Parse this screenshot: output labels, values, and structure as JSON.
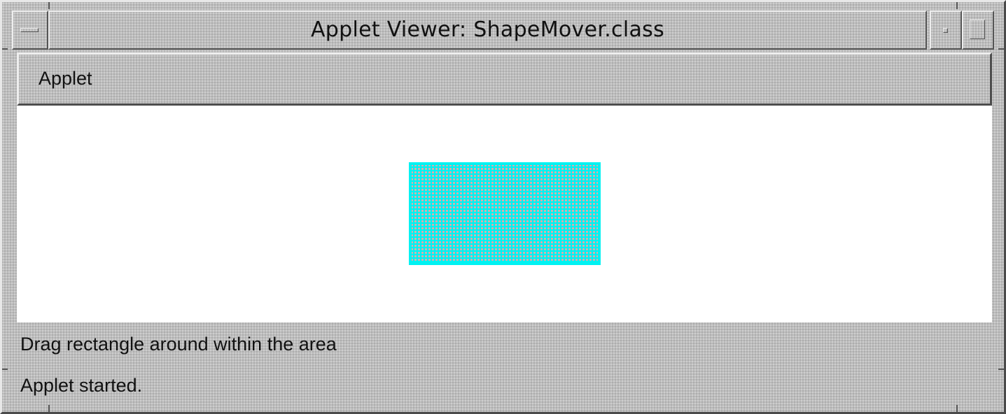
{
  "window": {
    "title": "Applet Viewer: ShapeMover.class"
  },
  "menubar": {
    "items": [
      {
        "label": "Applet"
      }
    ]
  },
  "applet": {
    "shape": {
      "fill_color": "#e8a8a8",
      "border_color": "#00f2f2"
    }
  },
  "status": {
    "instruction": "Drag rectangle around within the area",
    "message": "Applet started."
  },
  "colors": {
    "chrome_gray": "#bdbdbd",
    "canvas_bg": "#ffffff"
  },
  "icons": {
    "window_menu": "window-menu-icon",
    "minimize": "minimize-icon",
    "maximize": "maximize-icon"
  }
}
